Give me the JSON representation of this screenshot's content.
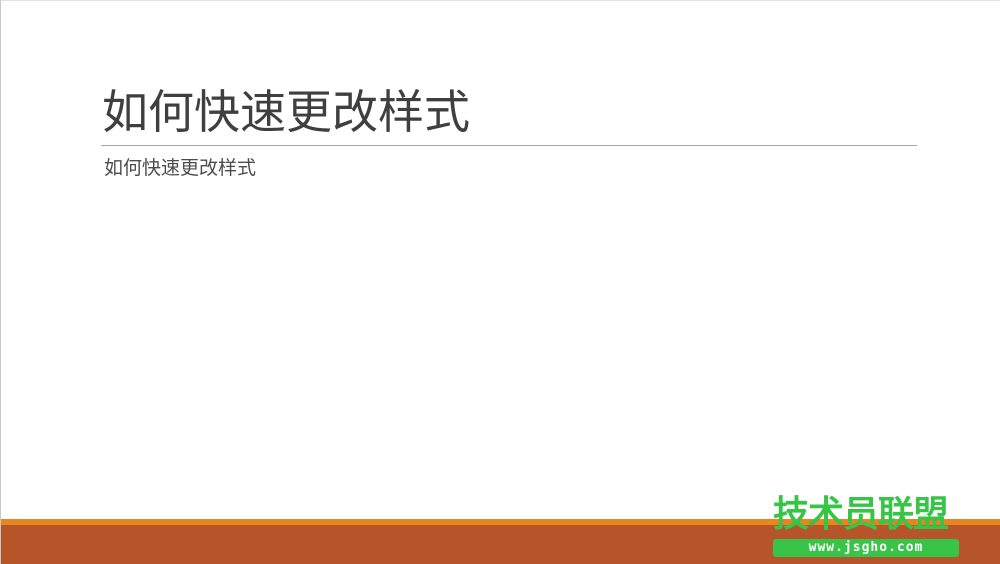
{
  "slide": {
    "title": "如何快速更改样式",
    "subtitle": "如何快速更改样式"
  },
  "watermark": {
    "text": "技术员联盟",
    "url": "www.jsgho.com"
  },
  "colors": {
    "title_text": "#3f3f3f",
    "accent_orange": "#e8851f",
    "footer_band": "#b6552a",
    "watermark_green": "#37c447"
  }
}
